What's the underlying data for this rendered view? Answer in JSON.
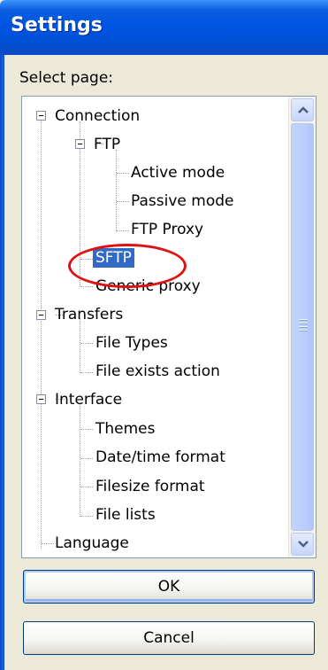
{
  "window": {
    "title": "Settings"
  },
  "panel": {
    "select_label": "Select page:"
  },
  "tree": {
    "nodes": {
      "connection": "Connection",
      "ftp": "FTP",
      "active_mode": "Active mode",
      "passive_mode": "Passive mode",
      "ftp_proxy": "FTP Proxy",
      "sftp": "SFTP",
      "generic_proxy": "Generic proxy",
      "transfers": "Transfers",
      "file_types": "File Types",
      "file_exists_action": "File exists action",
      "interface": "Interface",
      "themes": "Themes",
      "datetime_format": "Date/time format",
      "filesize_format": "Filesize format",
      "file_lists": "File lists",
      "language": "Language"
    },
    "selected": "SFTP"
  },
  "buttons": {
    "ok": "OK",
    "cancel": "Cancel"
  },
  "colors": {
    "title_bar": "#0054e3",
    "selection": "#316ac5",
    "annotation": "#e01010"
  }
}
